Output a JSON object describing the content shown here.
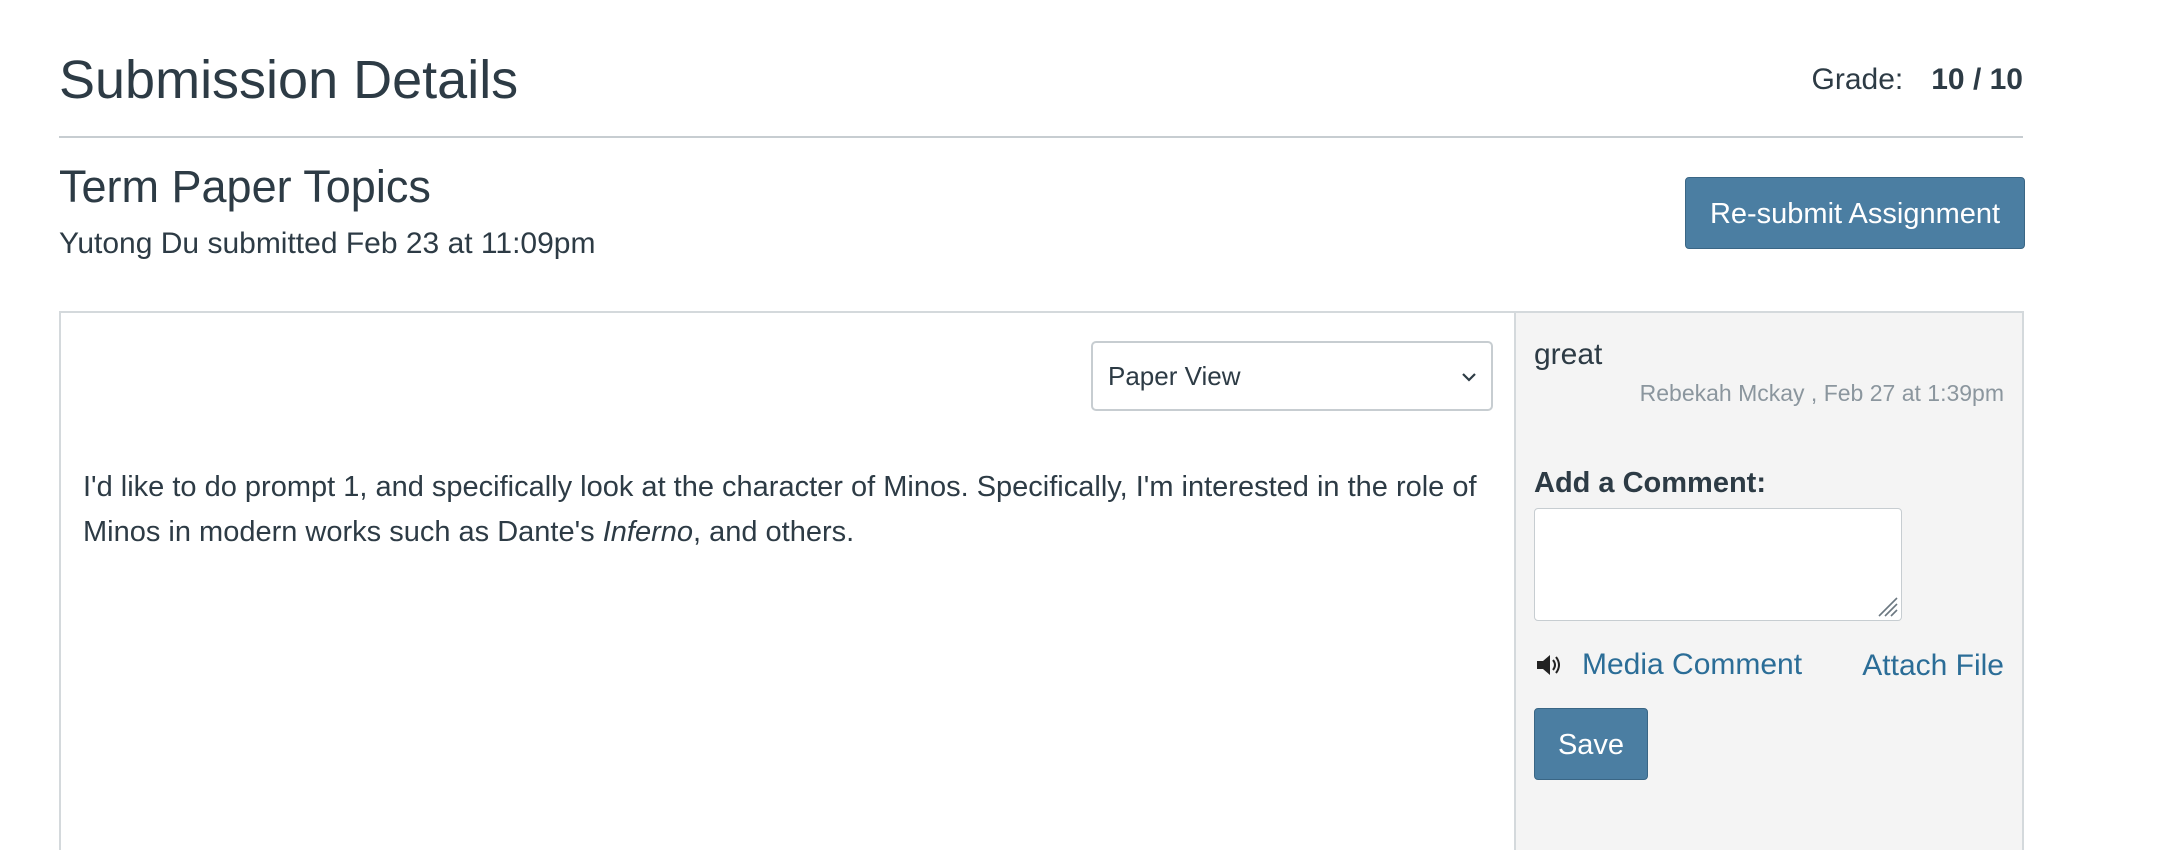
{
  "header": {
    "title": "Submission Details",
    "grade_label": "Grade:",
    "grade_value": "10 / 10"
  },
  "assignment": {
    "title": "Term Paper Topics",
    "submitted_line": "Yutong Du submitted Feb 23 at 11:09pm",
    "resubmit_label": "Re-submit Assignment"
  },
  "view_select": {
    "selected": "Paper View"
  },
  "submission": {
    "text_before": "I'd like to do prompt 1, and specifically look at the character of Minos. Specifically, I'm interested in the role of Minos in modern works such as Dante's ",
    "text_italic": "Inferno",
    "text_after": ", and others."
  },
  "comments": {
    "items": [
      {
        "text": "great",
        "meta": "Rebekah Mckay , Feb 27 at 1:39pm"
      }
    ],
    "add_label": "Add a Comment:",
    "textarea_value": "",
    "media_comment_label": "Media Comment",
    "media_icon": "speaker-icon",
    "attach_file_label": "Attach File",
    "save_label": "Save"
  },
  "colors": {
    "button_bg": "#4b7ea2",
    "link": "#2b6d97",
    "text": "#2d3b45",
    "muted": "#8b969e",
    "sidebar_bg": "#f4f4f4"
  }
}
